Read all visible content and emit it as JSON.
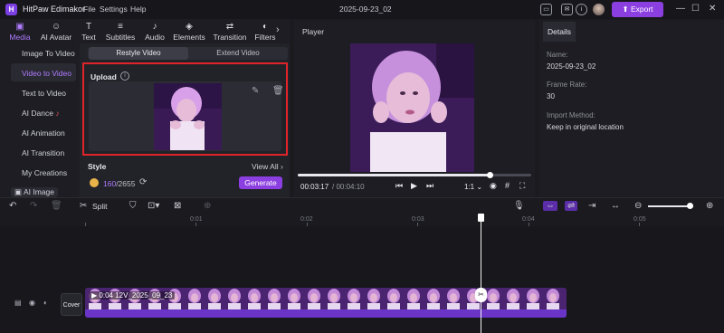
{
  "titlebar": {
    "app_title": "HitPaw Edimakor",
    "menus": [
      "File",
      "Settings",
      "Help"
    ],
    "doc_title": "2025-09-23_02",
    "export_label": "Export"
  },
  "categories": [
    {
      "label": "Media",
      "icon": "media-icon"
    },
    {
      "label": "AI Avatar",
      "icon": "avatar-icon"
    },
    {
      "label": "Text",
      "icon": "text-icon"
    },
    {
      "label": "Subtitles",
      "icon": "subtitles-icon"
    },
    {
      "label": "Audio",
      "icon": "audio-icon"
    },
    {
      "label": "Elements",
      "icon": "elements-icon"
    },
    {
      "label": "Transition",
      "icon": "transition-icon"
    },
    {
      "label": "Filters",
      "icon": "filters-icon"
    }
  ],
  "sidebar": {
    "items": [
      "Image To Video",
      "Video to Video",
      "Text to Video",
      "AI Dance",
      "AI Animation",
      "AI Transition",
      "My Creations",
      "AI Image"
    ],
    "active_index": 1
  },
  "panel": {
    "segments": [
      "Restyle Video",
      "Extend Video"
    ],
    "upload_label": "Upload",
    "style_label": "Style",
    "view_all": "View All",
    "credits_used": "160",
    "credits_total": "/2655",
    "generate_label": "Generate"
  },
  "player": {
    "title": "Player",
    "time_current": "00:03:17",
    "time_total": "/ 00:04:10",
    "speed": "1:1",
    "progress_fraction": 0.82
  },
  "details": {
    "tab": "Details",
    "name_label": "Name:",
    "name_value": "2025-09-23_02",
    "framerate_label": "Frame Rate:",
    "framerate_value": "30",
    "import_label": "Import Method:",
    "import_value": "Keep in original location"
  },
  "timeline": {
    "split_label": "Split",
    "ruler": [
      "0:01",
      "0:02",
      "0:03",
      "0:04",
      "0:05"
    ],
    "cover_label": "Cover",
    "clip_duration": "0:04",
    "clip_name": "12V_2025_09_23"
  },
  "colors": {
    "accent": "#8c3fe0",
    "accent_text": "#b07cff",
    "highlight_box": "#e0252a"
  }
}
